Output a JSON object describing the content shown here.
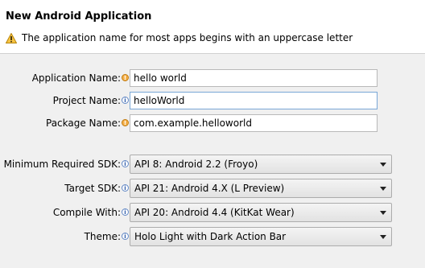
{
  "header": {
    "title": "New Android Application",
    "message": "The application name for most apps begins with an uppercase letter",
    "message_icon": "warning-icon"
  },
  "fields": {
    "application_name": {
      "label": "Application Name:",
      "value": "hello world",
      "decoration": "warning"
    },
    "project_name": {
      "label": "Project Name:",
      "value": "helloWorld",
      "decoration": "info"
    },
    "package_name": {
      "label": "Package Name:",
      "value": "com.example.helloworld",
      "decoration": "warning"
    }
  },
  "selects": {
    "min_sdk": {
      "label": "Minimum Required SDK:",
      "value": "API 8: Android 2.2 (Froyo)"
    },
    "target_sdk": {
      "label": "Target SDK:",
      "value": "API 21: Android 4.X (L Preview)"
    },
    "compile_with": {
      "label": "Compile With:",
      "value": "API 20: Android 4.4 (KitKat Wear)"
    },
    "theme": {
      "label": "Theme:",
      "value": "Holo Light with Dark Action Bar"
    }
  },
  "colors": {
    "warning": "#f4b04a",
    "info": "#5f86c4",
    "background": "#f0f0f0",
    "header_bg": "#ffffff"
  }
}
